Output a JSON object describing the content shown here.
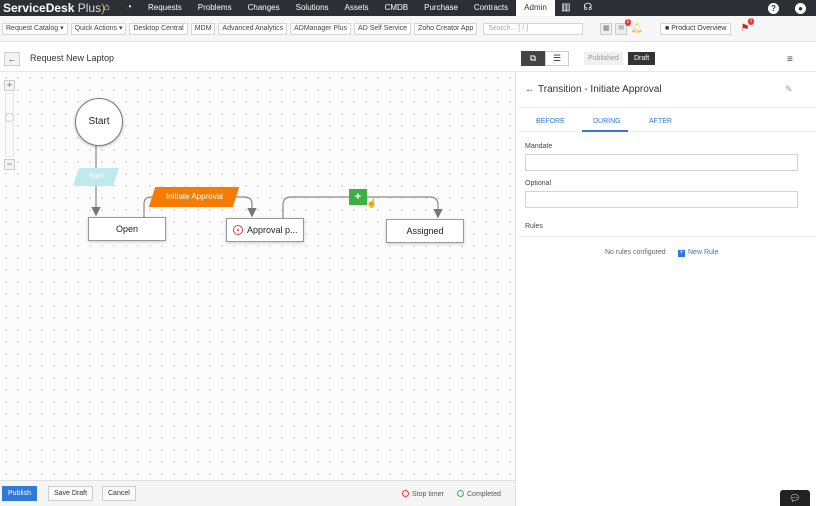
{
  "nav": {
    "brand": "ServiceDesk",
    "brand_plus": "Plus",
    "items": [
      "Requests",
      "Problems",
      "Changes",
      "Solutions",
      "Assets",
      "CMDB",
      "Purchase",
      "Contracts",
      "Admin"
    ],
    "active": "Admin",
    "icons": [
      "home-icon",
      "dashboard-icon",
      "reports-icon",
      "headset-icon",
      "help-icon",
      "user-icon"
    ],
    "help_glyph": "?"
  },
  "toolbar": {
    "buttons": [
      "Request Catalog ▾",
      "Quick Actions ▾",
      "Desktop Central",
      "MDM",
      "Advanced Analytics",
      "ADManager Plus",
      "AD Self Service",
      "Zoho Creator App"
    ],
    "search_placeholder": "Search... [ / ]",
    "product_overview": "Product Overview"
  },
  "header": {
    "title": "Request New Laptop",
    "published_tab": "Published",
    "draft_tab": "Draft"
  },
  "workflow": {
    "start_label": "Start",
    "start_transition": "Start",
    "nodes": {
      "open": "Open",
      "approval": "Approval p...",
      "assigned": "Assigned"
    },
    "transition_label": "Initiate Approval",
    "add_label": "+"
  },
  "footer": {
    "publish": "Publish",
    "save_draft": "Save Draft",
    "cancel": "Cancel",
    "legend_stop": "Stop timer",
    "legend_completed": "Completed"
  },
  "panel": {
    "title": "Transition - Initiate Approval",
    "tabs": [
      "BEFORE",
      "DURING",
      "AFTER"
    ],
    "active_tab": "DURING",
    "mandate_label": "Mandate",
    "optional_label": "Optional",
    "rules_label": "Rules",
    "no_rules": "No rules configured",
    "new_rule": "New Rule"
  },
  "colors": {
    "nav_bg": "#2c2f34",
    "accent": "#2f7ad6",
    "transition_orange": "#f57c00",
    "add_green": "#3cb043",
    "start_transition_teal": "#bfe9ea"
  }
}
